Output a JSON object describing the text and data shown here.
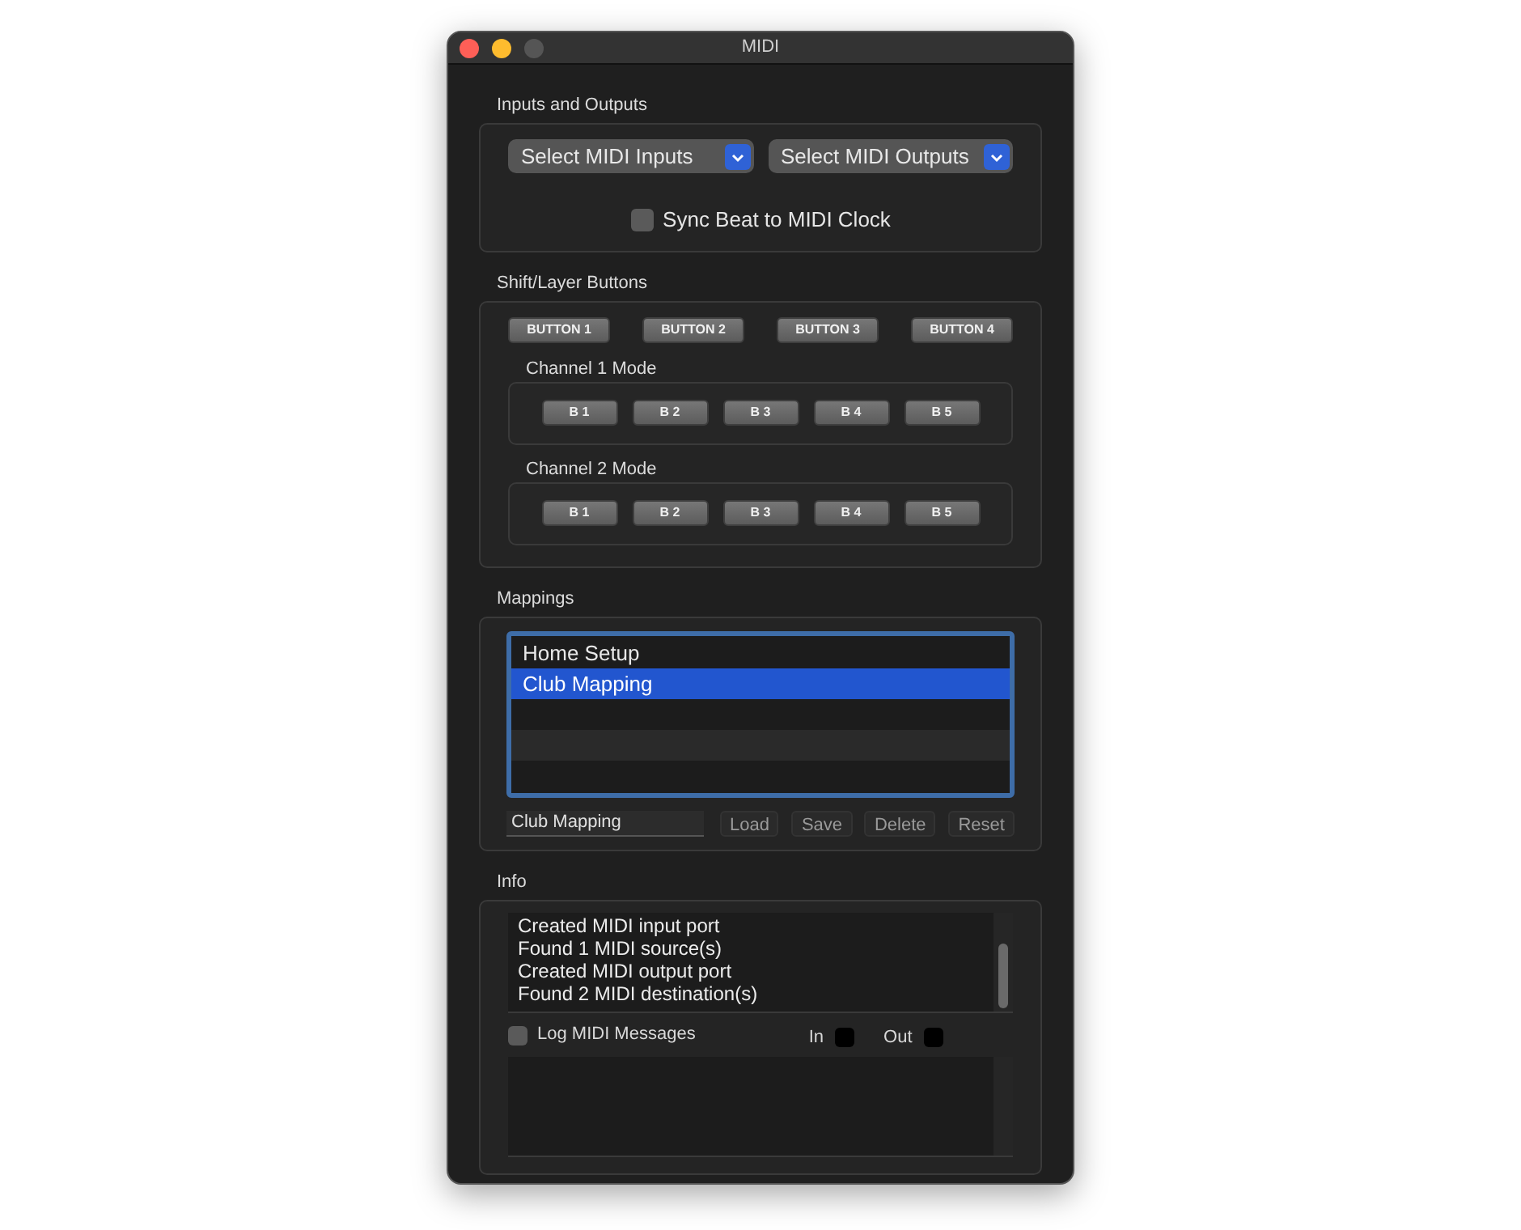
{
  "window": {
    "title": "MIDI"
  },
  "io": {
    "title": "Inputs and Outputs",
    "inputs": "Select MIDI Inputs",
    "outputs": "Select MIDI Outputs",
    "sync": {
      "label": "Sync Beat to MIDI Clock",
      "checked": false
    }
  },
  "shift": {
    "title": "Shift/Layer Buttons",
    "buttons": [
      "BUTTON 1",
      "BUTTON 2",
      "BUTTON 3",
      "BUTTON 4"
    ],
    "channels": [
      {
        "title": "Channel 1 Mode",
        "buttons": [
          "B 1",
          "B 2",
          "B 3",
          "B 4",
          "B 5"
        ]
      },
      {
        "title": "Channel 2 Mode",
        "buttons": [
          "B 1",
          "B 2",
          "B 3",
          "B 4",
          "B 5"
        ]
      }
    ]
  },
  "mappings": {
    "title": "Mappings",
    "items": [
      {
        "label": "Home Setup",
        "selected": false
      },
      {
        "label": "Club Mapping",
        "selected": true
      }
    ],
    "name_field": "Club Mapping",
    "buttons": [
      "Load",
      "Save",
      "Delete",
      "Reset"
    ]
  },
  "info": {
    "title": "Info",
    "log": [
      "Created MIDI input port",
      "Found 1 MIDI source(s)",
      "Created MIDI output port",
      "Found 2 MIDI destination(s)"
    ],
    "log_messages": {
      "label": "Log MIDI Messages",
      "checked": false
    },
    "indicators": [
      {
        "label": "In",
        "on": false
      },
      {
        "label": "Out",
        "on": false
      }
    ]
  }
}
